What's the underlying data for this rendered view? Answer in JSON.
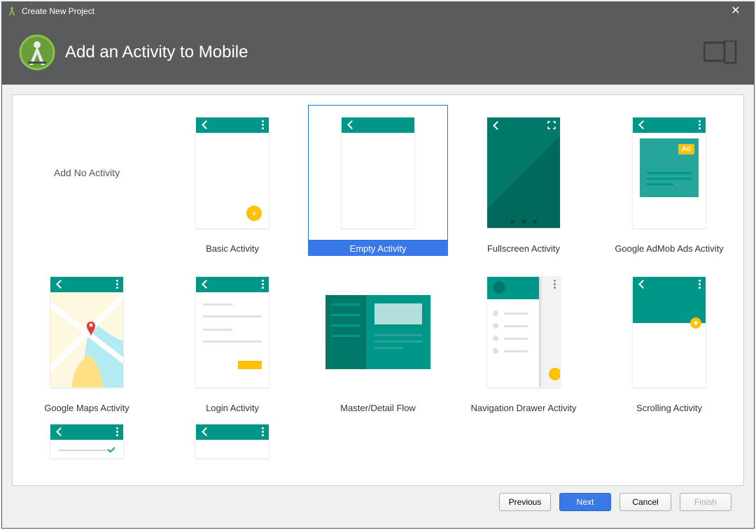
{
  "window": {
    "title": "Create New Project",
    "close_label": "✕"
  },
  "header": {
    "title": "Add an Activity to Mobile"
  },
  "activities": [
    {
      "id": "add-no-activity",
      "label": "Add No Activity"
    },
    {
      "id": "basic-activity",
      "label": "Basic Activity"
    },
    {
      "id": "empty-activity",
      "label": "Empty Activity",
      "selected": true
    },
    {
      "id": "fullscreen-activity",
      "label": "Fullscreen Activity"
    },
    {
      "id": "google-admob-ads-activity",
      "label": "Google AdMob Ads Activity",
      "ad_label": "Ad"
    },
    {
      "id": "google-maps-activity",
      "label": "Google Maps Activity"
    },
    {
      "id": "login-activity",
      "label": "Login Activity"
    },
    {
      "id": "master-detail-flow",
      "label": "Master/Detail Flow"
    },
    {
      "id": "navigation-drawer-activity",
      "label": "Navigation Drawer Activity"
    },
    {
      "id": "scrolling-activity",
      "label": "Scrolling Activity"
    },
    {
      "id": "settings-activity",
      "label": ""
    },
    {
      "id": "tabbed-activity",
      "label": ""
    }
  ],
  "buttons": {
    "previous": "Previous",
    "next": "Next",
    "cancel": "Cancel",
    "finish": "Finish"
  },
  "colors": {
    "brand_teal": "#009688",
    "accent_yellow": "#fec107",
    "selection_blue": "#3b78e7"
  }
}
